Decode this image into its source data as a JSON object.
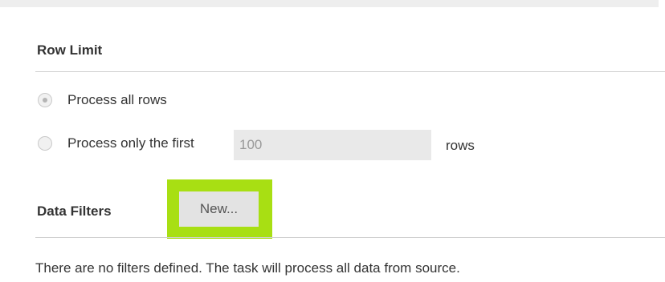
{
  "row_limit": {
    "heading": "Row Limit",
    "option_all_label": "Process all rows",
    "option_first_label": "Process only the first",
    "rows_value": "100",
    "rows_suffix": "rows",
    "selected_option": "Process all rows"
  },
  "data_filters": {
    "heading": "Data Filters",
    "new_button_label": "New...",
    "empty_message": "There are no filters defined. The task will process all data from source.",
    "highlight_color": "#a8df13"
  }
}
